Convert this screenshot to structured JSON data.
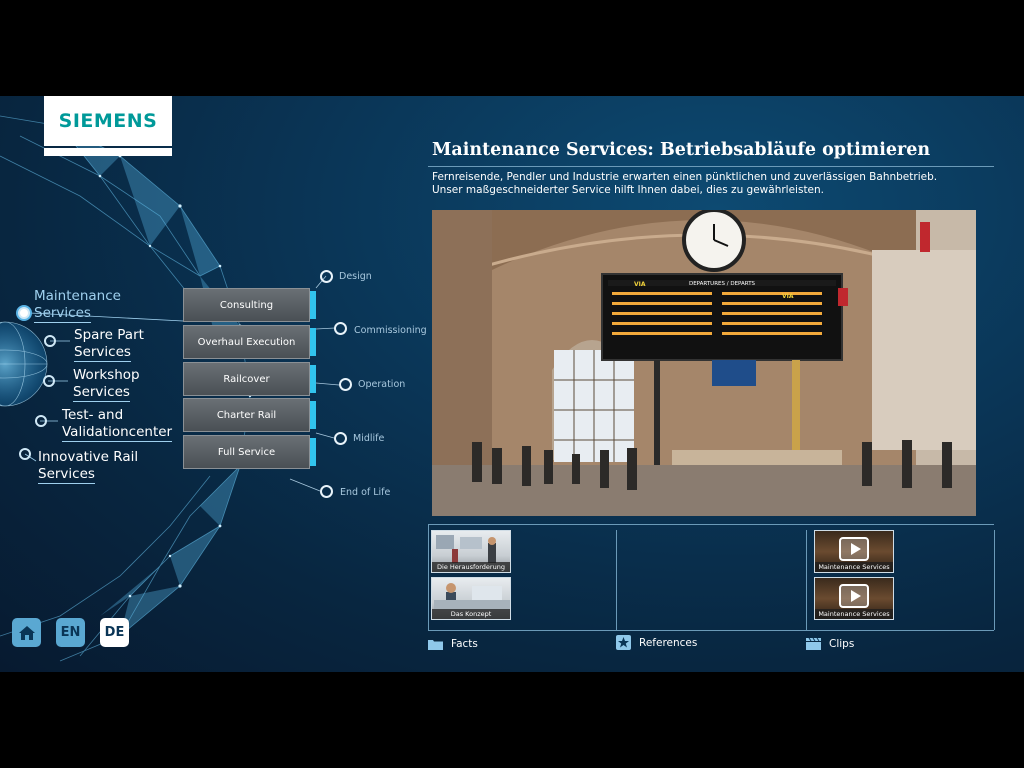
{
  "brand": {
    "logo_text": "SIEMENS"
  },
  "menu": {
    "items": [
      {
        "label_line1": "Maintenance",
        "label_line2": "Services",
        "active": true
      },
      {
        "label_line1": "Spare Part",
        "label_line2": "Services",
        "active": false
      },
      {
        "label_line1": "Workshop",
        "label_line2": "Services",
        "active": false
      },
      {
        "label_line1": "Test- and",
        "label_line2": "Validationcenter",
        "active": false
      },
      {
        "label_line1": "Innovative Rail",
        "label_line2": "Services",
        "active": false
      }
    ]
  },
  "services": {
    "buttons": [
      "Consulting",
      "Overhaul Execution",
      "Railcover",
      "Charter Rail",
      "Full Service"
    ]
  },
  "lifecycle": {
    "stages": [
      "Design",
      "Commissioning",
      "Operation",
      "Midlife",
      "End of Life"
    ]
  },
  "content": {
    "title": "Maintenance Services: Betriebsabläufe optimieren",
    "subtitle_line1": "Fernreisende, Pendler und Industrie erwarten einen pünktlichen und zuverlässigen Bahnbetrieb.",
    "subtitle_line2": "Unser maßgeschneiderter Service hilft Ihnen dabei, dies zu gewährleisten.",
    "photo_board_title": "DEPARTURES / DEPARTS",
    "photo_brand": "VIA"
  },
  "facts": {
    "thumbs": [
      "Die Herausforderung",
      "Das Konzept"
    ]
  },
  "clips": {
    "thumbs": [
      "Maintenance Services",
      "Maintenance Services"
    ]
  },
  "footer": {
    "facts_label": "Facts",
    "references_label": "References",
    "clips_label": "Clips"
  },
  "language": {
    "en_label": "EN",
    "de_label": "DE",
    "selected": "DE"
  },
  "colors": {
    "accent": "#31c4ee",
    "brand": "#009999",
    "background": "#0a3556"
  }
}
